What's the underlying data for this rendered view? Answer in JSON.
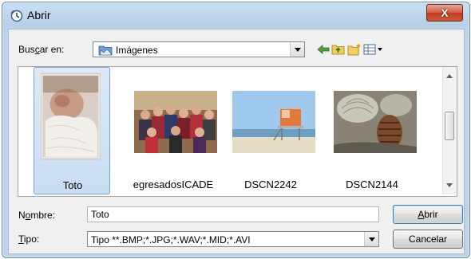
{
  "window": {
    "title": "Abrir",
    "close_label": "X"
  },
  "lookin": {
    "label_pre": "Bus",
    "label_key": "c",
    "label_post": "ar en:",
    "value": "Imágenes"
  },
  "files": [
    {
      "name": "Toto",
      "selected": true
    },
    {
      "name": "egresadosICADE",
      "selected": false
    },
    {
      "name": "DSCN2242",
      "selected": false
    },
    {
      "name": "DSCN2144",
      "selected": false
    }
  ],
  "filename": {
    "label_pre": "N",
    "label_key": "o",
    "label_post": "mbre:",
    "value": "Toto"
  },
  "filetype": {
    "label_key": "T",
    "label_post": "ipo:",
    "value": "Tipo **.BMP;*.JPG;*.WAV;*.MID;*.AVI"
  },
  "buttons": {
    "open_key": "A",
    "open_rest": "brir",
    "cancel": "Cancelar"
  },
  "colors": {
    "accent": "#3c7fb1",
    "selection": "#c8ddf3",
    "close": "#c03a1f"
  },
  "icons": [
    "clock-icon",
    "folder-pictures-icon",
    "back-arrow-icon",
    "up-folder-icon",
    "new-folder-icon",
    "view-menu-icon"
  ]
}
